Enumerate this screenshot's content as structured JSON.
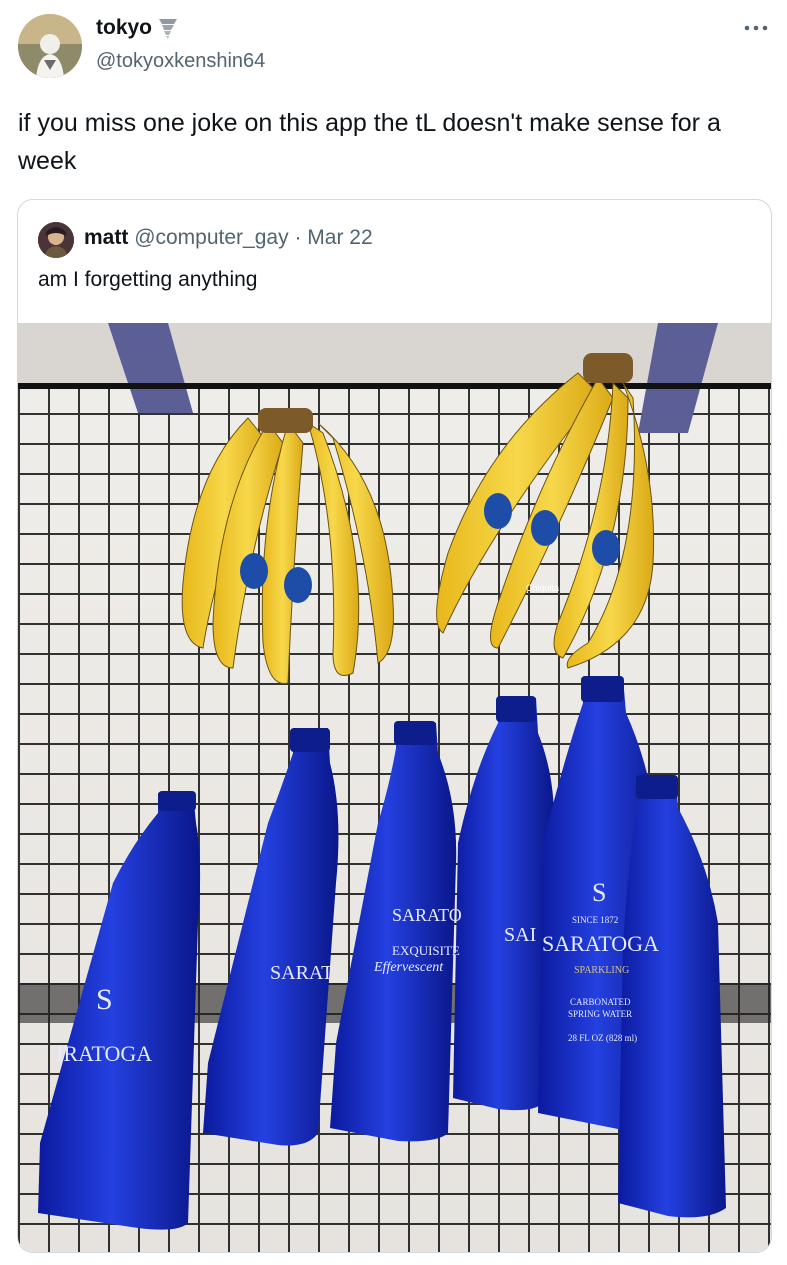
{
  "author": {
    "name": "tokyo",
    "handle": "@tokyoxkenshin64",
    "name_emoji_icon": "tornado-icon"
  },
  "more_icon": "more-horizontal-icon",
  "tweet_text": "if you miss one joke on this app the tL doesn't make sense for a week",
  "quoted": {
    "name": "matt",
    "handle": "@computer_gay",
    "separator": "·",
    "date": "Mar 22",
    "text": "am I forgetting anything"
  },
  "photo_text": {
    "brand": "SARATOGA",
    "brand_partial_left": "IRATOGA",
    "brand_partial_2": "SARAT",
    "brand_partial_3": "SARATO",
    "brand_partial_4": "SAI",
    "since": "SINCE 1872",
    "sparkling": "SPARKLING",
    "carbonated": "CARBONATED",
    "spring_water": "SPRING WATER",
    "volume": "28 FL OZ (828 ml)",
    "exquisite": "EXQUISITE",
    "effervescent": "Effervescent",
    "logo_s": "S",
    "banana_brand": "Chiquita"
  },
  "colors": {
    "text_primary": "#0f1419",
    "text_secondary": "#536471",
    "border": "#cfd9de",
    "bottle_blue": "#1a2fc4",
    "banana_yellow": "#f2cc2e",
    "cart_black": "#141414",
    "floor": "#e9e7e3"
  }
}
